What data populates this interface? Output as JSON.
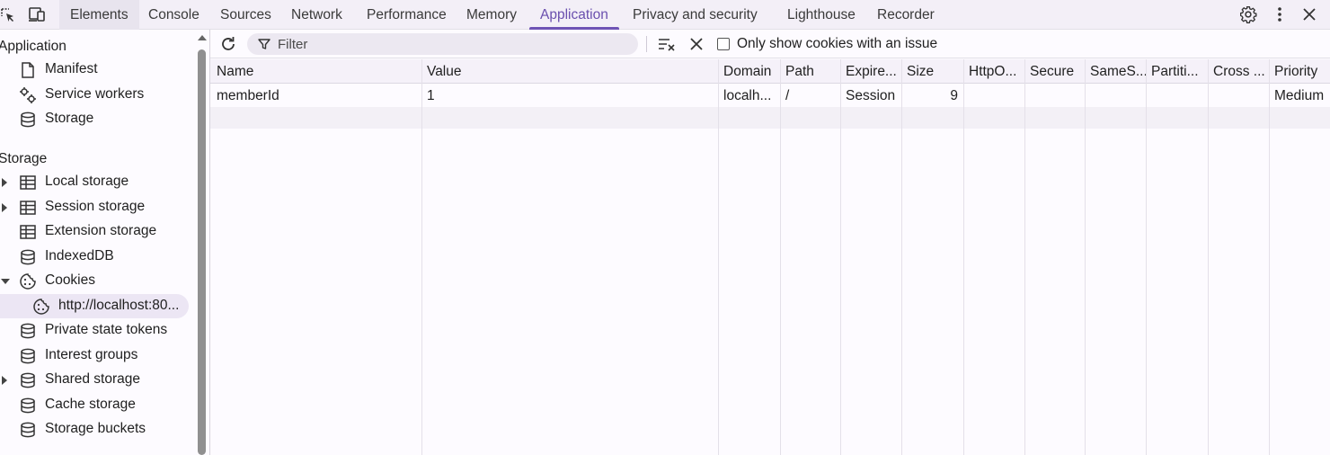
{
  "tabs": [
    "Elements",
    "Console",
    "Sources",
    "Network",
    "Performance",
    "Memory",
    "Application",
    "Privacy and security",
    "Lighthouse",
    "Recorder"
  ],
  "active_tab": "Application",
  "sidebar": {
    "application_title": "Application",
    "application_items": [
      "Manifest",
      "Service workers",
      "Storage"
    ],
    "storage_title": "Storage",
    "storage_items": [
      "Local storage",
      "Session storage",
      "Extension storage",
      "IndexedDB",
      "Cookies",
      "http://localhost:80...",
      "Private state tokens",
      "Interest groups",
      "Shared storage",
      "Cache storage",
      "Storage buckets"
    ]
  },
  "toolbar": {
    "filter_placeholder": "Filter",
    "only_issue_label": "Only show cookies with an issue"
  },
  "table": {
    "columns": [
      "Name",
      "Value",
      "Domain",
      "Path",
      "Expire...",
      "Size",
      "HttpO...",
      "Secure",
      "SameS...",
      "Partiti...",
      "Cross ...",
      "Priority"
    ],
    "rows": [
      [
        "memberId",
        "1",
        "localh...",
        "/",
        "Session",
        "9",
        "",
        "",
        "",
        "",
        "",
        "Medium"
      ]
    ]
  },
  "colors": {
    "accent": "#6f54b5",
    "selected_bg": "#ece6f4"
  }
}
